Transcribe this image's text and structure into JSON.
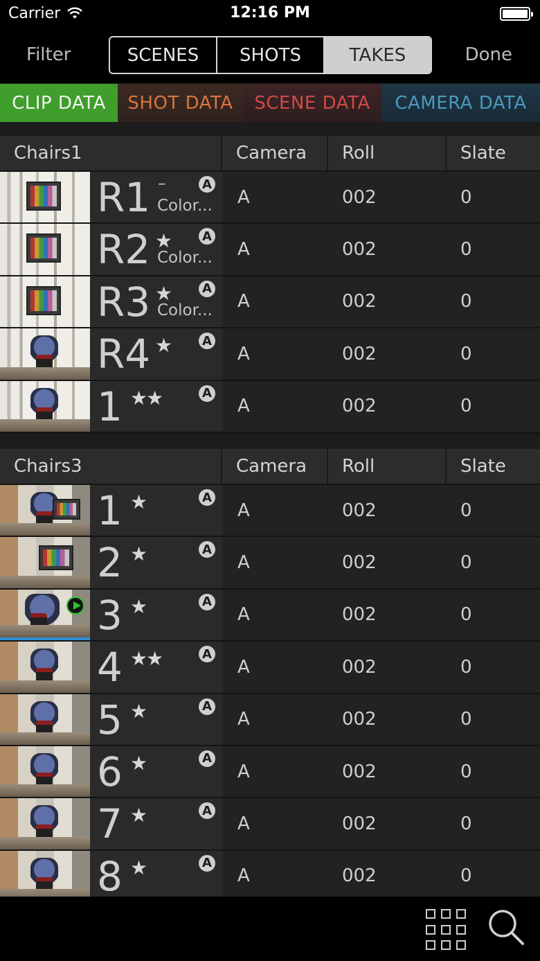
{
  "status": {
    "carrier": "Carrier",
    "time": "12:16 PM"
  },
  "nav": {
    "filter": "Filter",
    "done": "Done",
    "segments": [
      "SCENES",
      "SHOTS",
      "TAKES"
    ],
    "active_segment": "TAKES"
  },
  "data_tabs": [
    "CLIP DATA",
    "SHOT DATA",
    "SCENE DATA",
    "CAMERA DATA"
  ],
  "columns": {
    "camera": "Camera",
    "roll": "Roll",
    "slate": "Slate"
  },
  "sections": [
    {
      "name": "Chairs1",
      "rows": [
        {
          "take": "R1",
          "rating": "–",
          "note": "Color...",
          "badge": "A",
          "camera": "A",
          "roll": "002",
          "slate": "0"
        },
        {
          "take": "R2",
          "rating": "★",
          "note": "Color...",
          "badge": "A",
          "camera": "A",
          "roll": "002",
          "slate": "0"
        },
        {
          "take": "R3",
          "rating": "★",
          "note": "Color...",
          "badge": "A",
          "camera": "A",
          "roll": "002",
          "slate": "0"
        },
        {
          "take": "R4",
          "rating": "★",
          "note": "",
          "badge": "A",
          "camera": "A",
          "roll": "002",
          "slate": "0"
        },
        {
          "take": "1",
          "rating": "★★",
          "note": "",
          "badge": "A",
          "camera": "A",
          "roll": "002",
          "slate": "0"
        }
      ]
    },
    {
      "name": "Chairs3",
      "rows": [
        {
          "take": "1",
          "rating": "★",
          "note": "",
          "badge": "A",
          "camera": "A",
          "roll": "002",
          "slate": "0"
        },
        {
          "take": "2",
          "rating": "★",
          "note": "",
          "badge": "A",
          "camera": "A",
          "roll": "002",
          "slate": "0"
        },
        {
          "take": "3",
          "rating": "★",
          "note": "",
          "badge": "A",
          "camera": "A",
          "roll": "002",
          "slate": "0"
        },
        {
          "take": "4",
          "rating": "★★",
          "note": "",
          "badge": "A",
          "camera": "A",
          "roll": "002",
          "slate": "0"
        },
        {
          "take": "5",
          "rating": "★",
          "note": "",
          "badge": "A",
          "camera": "A",
          "roll": "002",
          "slate": "0"
        },
        {
          "take": "6",
          "rating": "★",
          "note": "",
          "badge": "A",
          "camera": "A",
          "roll": "002",
          "slate": "0"
        },
        {
          "take": "7",
          "rating": "★",
          "note": "",
          "badge": "A",
          "camera": "A",
          "roll": "002",
          "slate": "0"
        },
        {
          "take": "8",
          "rating": "★",
          "note": "",
          "badge": "A",
          "camera": "A",
          "roll": "002",
          "slate": "0"
        }
      ]
    }
  ],
  "icons": {
    "grid": "grid-view-icon",
    "search": "search-icon",
    "play": "play-icon",
    "wifi": "wifi-icon",
    "battery": "battery-icon"
  },
  "colors": {
    "clip": "#3f9e2c",
    "shot": "#d9743f",
    "scene": "#cf4a47",
    "camera": "#4c98bf"
  }
}
